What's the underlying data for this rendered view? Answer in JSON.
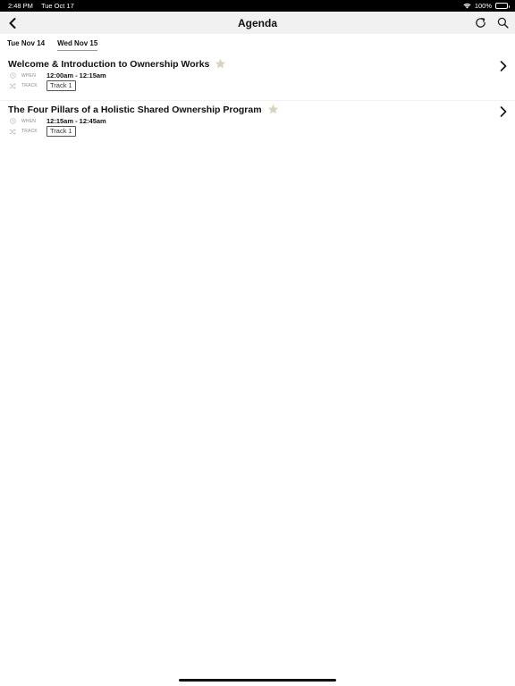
{
  "status_bar": {
    "time": "2:48 PM",
    "date": "Tue Oct 17",
    "battery": "100%"
  },
  "nav": {
    "title": "Agenda",
    "icons": [
      "chevron-left-icon",
      "refresh-icon",
      "search-icon"
    ]
  },
  "day_tabs": [
    {
      "label": "Tue Nov 14",
      "selected": false
    },
    {
      "label": "Wed Nov 15",
      "selected": true
    }
  ],
  "sessions": [
    {
      "title": "Welcome & Introduction to Ownership Works",
      "when_label": "WHEN",
      "when": "12:00am - 12:15am",
      "track_label": "TRACK",
      "track": "Track 1",
      "starred": false
    },
    {
      "title": "The Four Pillars of a Holistic Shared Ownership Program",
      "when_label": "WHEN",
      "when": "12:15am - 12:45am",
      "track_label": "TRACK",
      "track": "Track 1",
      "starred": false
    }
  ],
  "colors": {
    "nav_background": "#f1f1f1",
    "star": "#d9d2bd",
    "meta_label": "#8a8a8a"
  }
}
